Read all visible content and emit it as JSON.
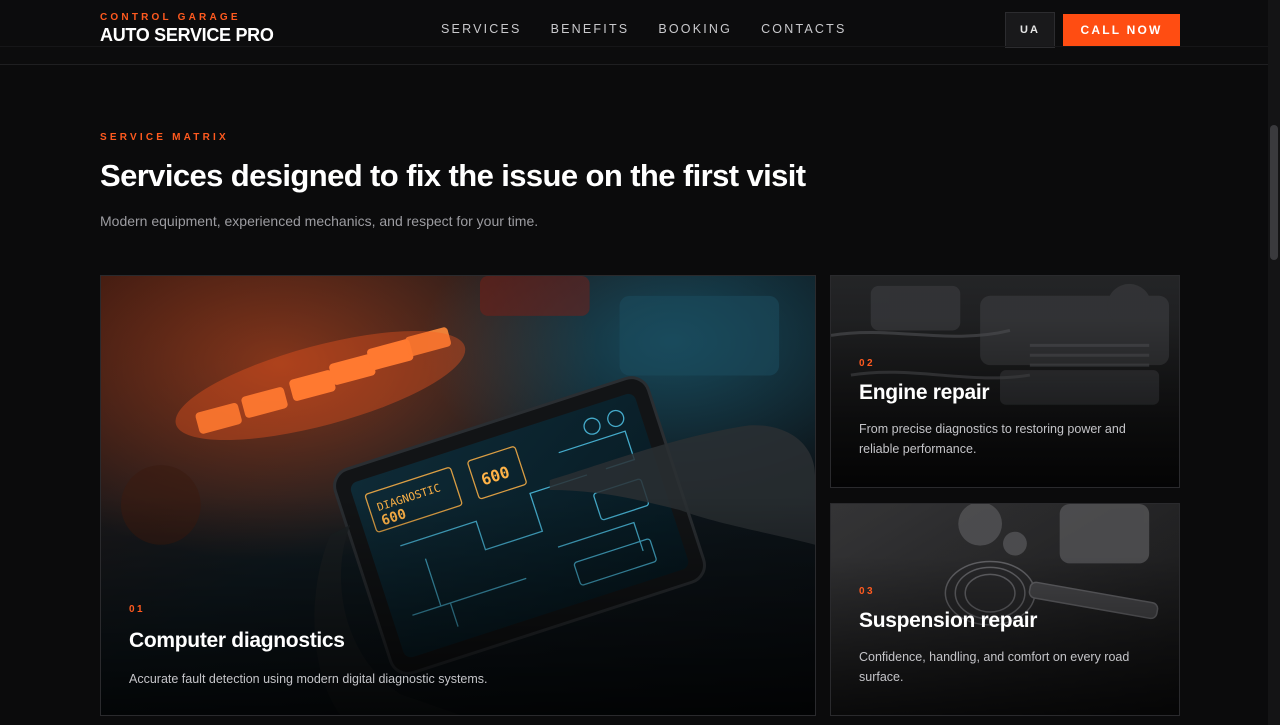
{
  "brand": {
    "tagline": "CONTROL GARAGE",
    "name": "AUTO SERVICE PRO"
  },
  "nav": {
    "items": [
      {
        "label": "SERVICES"
      },
      {
        "label": "BENEFITS"
      },
      {
        "label": "BOOKING"
      },
      {
        "label": "CONTACTS"
      }
    ]
  },
  "header_actions": {
    "language_label": "UA",
    "call_label": "CALL NOW"
  },
  "section": {
    "eyebrow": "SERVICE MATRIX",
    "title": "Services designed to fix the issue on the first visit",
    "subtitle": "Modern equipment, experienced mechanics, and respect for your time."
  },
  "services": [
    {
      "number": "01",
      "title": "Computer diagnostics",
      "description": "Accurate fault detection using modern digital diagnostic systems.",
      "image_icon": "tablet-diagnostics-photo",
      "tablet_readouts": [
        "DIAGNOSTIC 600",
        "600"
      ]
    },
    {
      "number": "02",
      "title": "Engine repair",
      "description": "From precise diagnostics to restoring power and reliable performance.",
      "image_icon": "engine-bay-photo"
    },
    {
      "number": "03",
      "title": "Suspension repair",
      "description": "Confidence, handling, and comfort on every road surface.",
      "image_icon": "suspension-photo"
    }
  ],
  "colors": {
    "accent": "#ff4d12",
    "background": "#0b0b0c",
    "text_muted": "#9c9ca1"
  }
}
